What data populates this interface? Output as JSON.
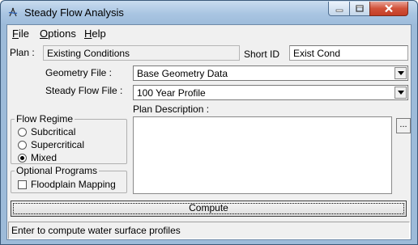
{
  "window": {
    "title": "Steady Flow Analysis",
    "icon": "hec-ras-app-icon"
  },
  "menu": [
    {
      "label": "File",
      "accel": "F",
      "rest": "ile"
    },
    {
      "label": "Options",
      "accel": "O",
      "rest": "ptions"
    },
    {
      "label": "Help",
      "accel": "H",
      "rest": "elp"
    }
  ],
  "plan": {
    "label": "Plan :",
    "value": "Existing Conditions",
    "short_id_label": "Short ID",
    "short_id_value": "Exist Cond"
  },
  "geometry": {
    "label": "Geometry File :",
    "value": "Base Geometry Data"
  },
  "steady_flow": {
    "label": "Steady Flow File :",
    "value": "100 Year Profile"
  },
  "description": {
    "label": "Plan Description :",
    "value": "",
    "browse_label": "..."
  },
  "flow_regime": {
    "title": "Flow Regime",
    "options": [
      {
        "label": "Subcritical",
        "selected": false
      },
      {
        "label": "Supercritical",
        "selected": false
      },
      {
        "label": "Mixed",
        "selected": true
      }
    ]
  },
  "optional_programs": {
    "title": "Optional Programs",
    "floodplain_mapping": {
      "label": "Floodplain Mapping",
      "checked": false
    }
  },
  "compute_label": "Compute",
  "status_text": "Enter to compute water surface profiles"
}
